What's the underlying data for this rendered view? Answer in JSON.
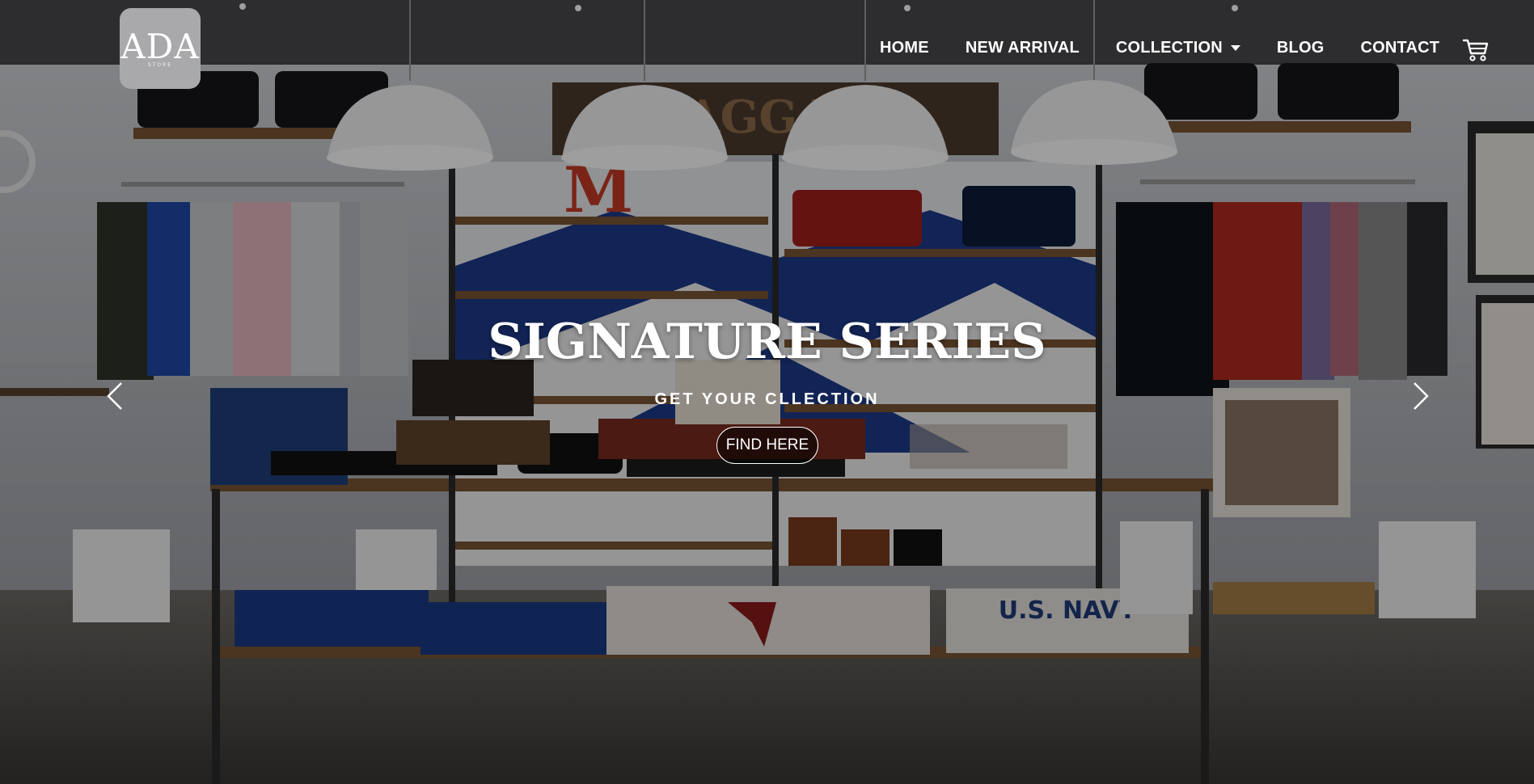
{
  "logo": {
    "text": "ADA",
    "sub": "STORE"
  },
  "nav": {
    "items": [
      "HOME",
      "NEW ARRIVAL",
      "COLLECTION",
      "BLOG",
      "CONTACT"
    ],
    "cart_icon": "cart-icon"
  },
  "hero": {
    "title": "SIGNATURE SERIES",
    "subtitle": "GET YOUR CLLECTION",
    "button": "FIND HERE",
    "prev_icon": "chevron-left-icon",
    "next_icon": "chevron-right-icon"
  },
  "colors": {
    "accent": "#ffffff",
    "overlay": "#000000"
  },
  "scene": {
    "shelf_text": "BAGGAGE",
    "shelf_letter": "M",
    "shirt_text": "U.S. NAVY"
  }
}
